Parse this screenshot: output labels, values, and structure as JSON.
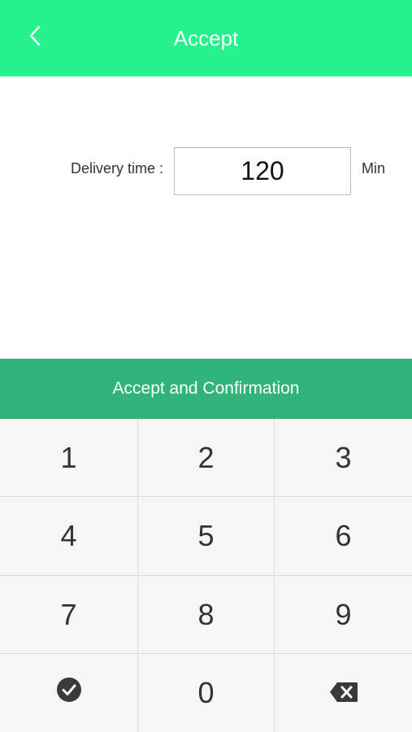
{
  "header": {
    "title": "Accept",
    "back_icon": "chevron-left-icon",
    "background": "#23f28d"
  },
  "form": {
    "label": "Delivery time :",
    "value": "120",
    "unit": "Min"
  },
  "confirm": {
    "label": "Accept and Confirmation",
    "background": "#30b47c"
  },
  "keypad": {
    "keys": [
      "1",
      "2",
      "3",
      "4",
      "5",
      "6",
      "7",
      "8",
      "9",
      "0"
    ],
    "confirm_icon": "check-circle-icon",
    "delete_icon": "backspace-icon"
  }
}
